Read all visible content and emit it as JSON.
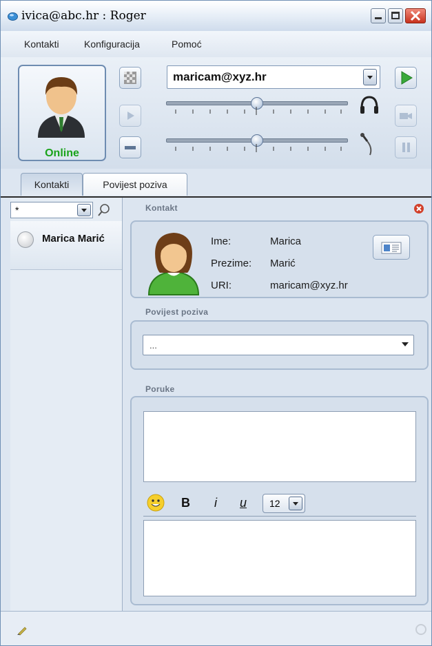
{
  "window": {
    "title": "ivica@abc.hr : Roger"
  },
  "menu": {
    "items": [
      "Kontakti",
      "Konfiguracija",
      "Pomoć"
    ]
  },
  "toolbar": {
    "status_label": "Online",
    "selected_contact": "maricam@xyz.hr",
    "speaker_volume": 0.5,
    "mic_volume": 0.5
  },
  "tabs": [
    {
      "label": "Kontakti",
      "active": true
    },
    {
      "label": "Povijest poziva",
      "active": false
    }
  ],
  "contacts": {
    "filter_value": "*",
    "items": [
      {
        "name": "Marica Marić"
      }
    ]
  },
  "contact_panel": {
    "title": "Kontakt",
    "fields": [
      {
        "label": "Ime:",
        "value": "Marica"
      },
      {
        "label": "Prezime:",
        "value": "Marić"
      },
      {
        "label": "URI:",
        "value": "maricam@xyz.hr"
      }
    ]
  },
  "call_history": {
    "title": "Povijest poziva",
    "value": "..."
  },
  "messages": {
    "title": "Poruke",
    "font_size": "12",
    "bold_label": "B",
    "italic_label": "i",
    "underline_label": "u"
  }
}
